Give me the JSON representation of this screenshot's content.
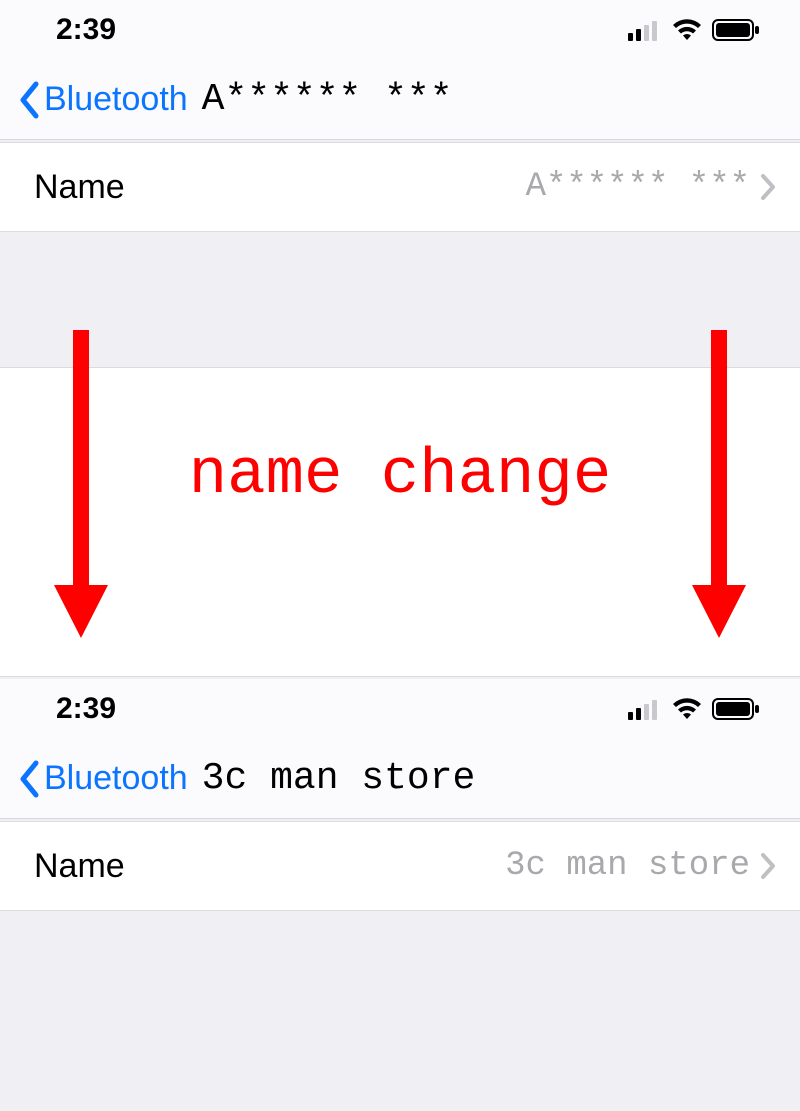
{
  "status_time": "2:39",
  "nav_back_label": "Bluetooth",
  "row_name_label": "Name",
  "before": {
    "device_title": "A****** ***",
    "device_value": "A****** ***"
  },
  "after": {
    "device_title": "3c man store",
    "device_value": "3c man store"
  },
  "annotation_text": "name change"
}
